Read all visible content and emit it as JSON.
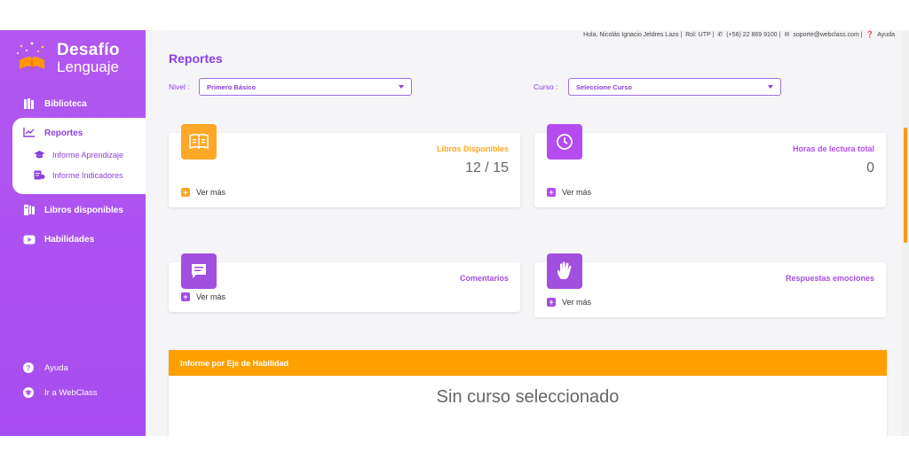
{
  "logo": {
    "title": "Desafío",
    "subtitle": "Lenguaje"
  },
  "sidebar": {
    "items": [
      {
        "label": "Biblioteca",
        "icon": "books-icon"
      },
      {
        "label": "Reportes",
        "icon": "chart-line-icon"
      },
      {
        "label": "Libros disponibles",
        "icon": "book-list-icon"
      },
      {
        "label": "Habilidades",
        "icon": "play-icon"
      }
    ],
    "subitems": [
      {
        "label": "Informe Aprendizaje",
        "icon": "graduation-cap-icon"
      },
      {
        "label": "Informe Indicadores",
        "icon": "report-icon"
      }
    ],
    "bottom": [
      {
        "label": "Ayuda",
        "icon": "question-icon"
      },
      {
        "label": "Ir a WebClass",
        "icon": "cap-icon"
      }
    ]
  },
  "topbar": {
    "greeting": "Hola, Nicolás Ignacio Jeldres Lazo",
    "role": "Rol: UTP",
    "phone": "(+56) 22 869 9100",
    "email": "soporte@webclass.com",
    "help": "Ayuda"
  },
  "page": {
    "title": "Reportes"
  },
  "filters": {
    "nivel_label": "Nivel :",
    "nivel_value": "Primero Básico",
    "curso_label": "Curso :",
    "curso_value": "Seleccione Curso"
  },
  "cards": [
    {
      "label": "Libros Disponibles",
      "value": "12 / 15",
      "more": "Ver más",
      "color": "#ffa726"
    },
    {
      "label": "Horas de lectura total",
      "value": "0",
      "more": "Ver más",
      "color": "#b44cf0"
    },
    {
      "label": "Comentarios",
      "more": "Ver más",
      "color": "#a24fdf"
    },
    {
      "label": "Respuestas emociones",
      "more": "Ver más",
      "color": "#a24fdf"
    }
  ],
  "report": {
    "header": "Informe por Eje de Habilidad",
    "empty": "Sin curso seleccionado"
  },
  "colors": {
    "primary": "#8a3fe0",
    "sidebar": "#b258f0",
    "accent": "#ffa000"
  }
}
